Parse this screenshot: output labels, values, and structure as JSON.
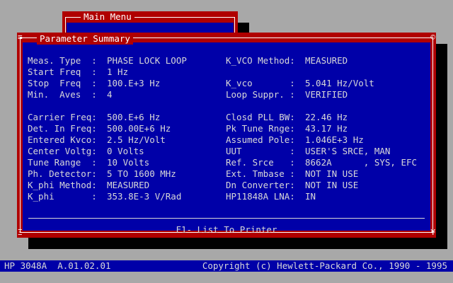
{
  "menu": {
    "title": "Main Menu"
  },
  "summary": {
    "title": "Parameter Summary",
    "corner_tl": "≡",
    "corner_tr": "©",
    "corner_bl": "Ξ",
    "corner_br": "¥",
    "left_fields": [
      {
        "label": "Meas. Type  :",
        "value": "PHASE LOCK LOOP"
      },
      {
        "label": "Start Freq  :",
        "value": "1 Hz"
      },
      {
        "label": "Stop  Freq  :",
        "value": "100.E+3 Hz"
      },
      {
        "label": "Min.  Aves  :",
        "value": "4"
      },
      {
        "label": "Carrier Freq:",
        "value": "500.E+6 Hz"
      },
      {
        "label": "Det. In Freq:",
        "value": "500.00E+6 Hz"
      },
      {
        "label": "Entered Kvco:",
        "value": "2.5 Hz/Volt"
      },
      {
        "label": "Center Voltg:",
        "value": "0 Volts"
      },
      {
        "label": "Tune Range  :",
        "value": "10 Volts"
      },
      {
        "label": "Ph. Detector:",
        "value": "5 TO 1600 MHz"
      },
      {
        "label": "K_phi Method:",
        "value": "MEASURED"
      },
      {
        "label": "K_phi       :",
        "value": "353.8E-3 V/Rad"
      }
    ],
    "right_fields": [
      {
        "label": "K_VCO Method:",
        "value": "MEASURED"
      },
      {
        "label": "K_vco       :",
        "value": "5.041 Hz/Volt"
      },
      {
        "label": "Loop Suppr. :",
        "value": "VERIFIED"
      },
      {
        "label": "Closd PLL BW:",
        "value": "22.46 Hz"
      },
      {
        "label": "Pk Tune Rnge:",
        "value": "43.17 Hz"
      },
      {
        "label": "Assumed Pole:",
        "value": "1.046E+3 Hz"
      },
      {
        "label": "UUT         :",
        "value": "USER'S SRCE, MAN"
      },
      {
        "label": "Ref. Srce   :",
        "value": "8662A      , SYS, EFC"
      },
      {
        "label": "Ext. Tmbase :",
        "value": "NOT IN USE"
      },
      {
        "label": "Dn Converter:",
        "value": "NOT IN USE"
      },
      {
        "label": "HP11848A LNA:",
        "value": "IN"
      }
    ],
    "f1_label": "F1- List To Printer"
  },
  "status": {
    "left": "HP 3048A  A.01.02.01",
    "right": "Copyright (c) Hewlett-Packard Co., 1990 - 1995"
  },
  "colors": {
    "desktop": "#a8a8a8",
    "window_blue": "#0000a8",
    "frame_red": "#b00000",
    "text": "#d8d8d8"
  }
}
